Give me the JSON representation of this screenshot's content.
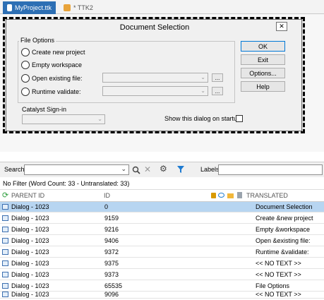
{
  "tabs": [
    {
      "label": "MyProject.ttk",
      "active": true
    },
    {
      "label": "* TTK2",
      "active": false
    }
  ],
  "dialog": {
    "title": "Document Selection",
    "close_glyph": "✕",
    "file_options_label": "File Options",
    "options": [
      "Create new project",
      "Empty workspace",
      "Open existing file:",
      "Runtime validate:"
    ],
    "browse_label": "...",
    "catalyst_label": "Catalyst Sign-in",
    "show_dialog_label": "Show this dialog on startup",
    "buttons": [
      "OK",
      "Exit",
      "Options...",
      "Help"
    ]
  },
  "search": {
    "label": "Search",
    "labels_label": "Labels",
    "value": ""
  },
  "filter_status": "No Filter (Word Count: 33 - Untranslated: 33)",
  "grid": {
    "columns": [
      "PARENT ID",
      "ID",
      "TRANSLATED"
    ],
    "rows": [
      {
        "parent": "Dialog - 1023",
        "id": "0",
        "translated": "Document Selection",
        "selected": true
      },
      {
        "parent": "Dialog - 1023",
        "id": "9159",
        "translated": "Create &new project"
      },
      {
        "parent": "Dialog - 1023",
        "id": "9216",
        "translated": "Empty &workspace"
      },
      {
        "parent": "Dialog - 1023",
        "id": "9406",
        "translated": "Open &existing file:"
      },
      {
        "parent": "Dialog - 1023",
        "id": "9372",
        "translated": "Runtime &validate:"
      },
      {
        "parent": "Dialog - 1023",
        "id": "9375",
        "translated": "<< NO TEXT >>"
      },
      {
        "parent": "Dialog - 1023",
        "id": "9373",
        "translated": "<< NO TEXT >>"
      },
      {
        "parent": "Dialog - 1023",
        "id": "65535",
        "translated": "File Options"
      },
      {
        "parent": "Dialog - 1023",
        "id": "9096",
        "translated": "<< NO TEXT >>"
      }
    ]
  },
  "colors": {
    "accent": "#2d6fb4",
    "selected_row": "#b7d5f1",
    "filter_icon": "#1e7bd1",
    "refresh_icon": "#2e9e3e",
    "lock_icon": "#d99a00",
    "folder_icon": "#f2b73b"
  }
}
